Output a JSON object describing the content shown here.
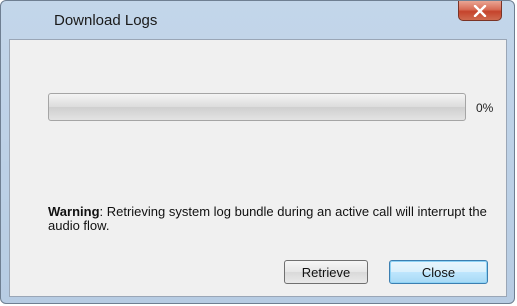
{
  "window": {
    "title": "Download Logs"
  },
  "progress": {
    "value": 0,
    "label": "0%"
  },
  "warning": {
    "label": "Warning",
    "message": ": Retrieving system log bundle during an active call will interrupt the audio flow."
  },
  "buttons": {
    "retrieve": "Retrieve",
    "close": "Close"
  },
  "icons": {
    "close": "close-x-icon"
  },
  "colors": {
    "close_button": "#c5432c",
    "progress_fill": "#6bc26b"
  }
}
